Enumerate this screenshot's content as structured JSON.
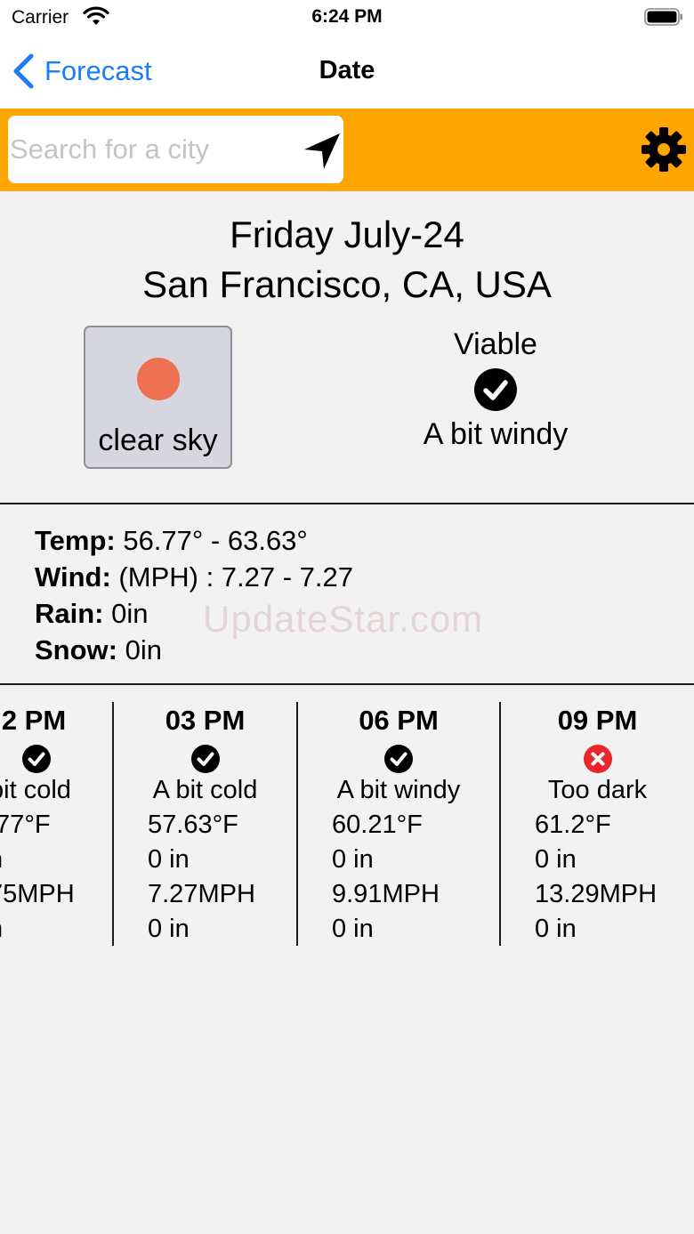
{
  "status_bar": {
    "carrier": "Carrier",
    "time": "6:24 PM"
  },
  "nav": {
    "back_label": "Forecast",
    "title": "Date"
  },
  "search": {
    "placeholder": "Search for a city",
    "value": ""
  },
  "forecast": {
    "day": "Friday July-24",
    "city": "San Francisco, CA, USA",
    "condition": "clear sky",
    "viability": "Viable",
    "viability_note": "A bit windy"
  },
  "summary": {
    "temp_label": "Temp:",
    "temp_value": "56.77° - 63.63°",
    "wind_label": "Wind:",
    "wind_value": "(MPH) : 7.27 - 7.27",
    "rain_label": "Rain:",
    "rain_value": "0in",
    "snow_label": "Snow:",
    "snow_value": "0in"
  },
  "watermark": "UpdateStar.com",
  "hourly": [
    {
      "time": "2 PM",
      "status": "ok",
      "note": "bit cold",
      "temp": ".77°F",
      "rain": "n",
      "wind": "75MPH",
      "snow": "n"
    },
    {
      "time": "03 PM",
      "status": "ok",
      "note": "A bit cold",
      "temp": "57.63°F",
      "rain": "0 in",
      "wind": "7.27MPH",
      "snow": "0 in"
    },
    {
      "time": "06 PM",
      "status": "ok",
      "note": "A bit windy",
      "temp": "60.21°F",
      "rain": "0 in",
      "wind": "9.91MPH",
      "snow": "0 in"
    },
    {
      "time": "09 PM",
      "status": "bad",
      "note": "Too dark",
      "temp": "61.2°F",
      "rain": "0 in",
      "wind": "13.29MPH",
      "snow": "0 in"
    }
  ],
  "colors": {
    "accent_blue": "#1a7ef8",
    "toolbar_orange": "#ffa500",
    "sun": "#ee7151",
    "error_red": "#e8262c"
  },
  "icons": [
    "wifi-icon",
    "battery-icon",
    "chevron-left-icon",
    "location-arrow-icon",
    "gear-icon",
    "sun-icon",
    "check-circle-icon",
    "x-circle-icon"
  ]
}
